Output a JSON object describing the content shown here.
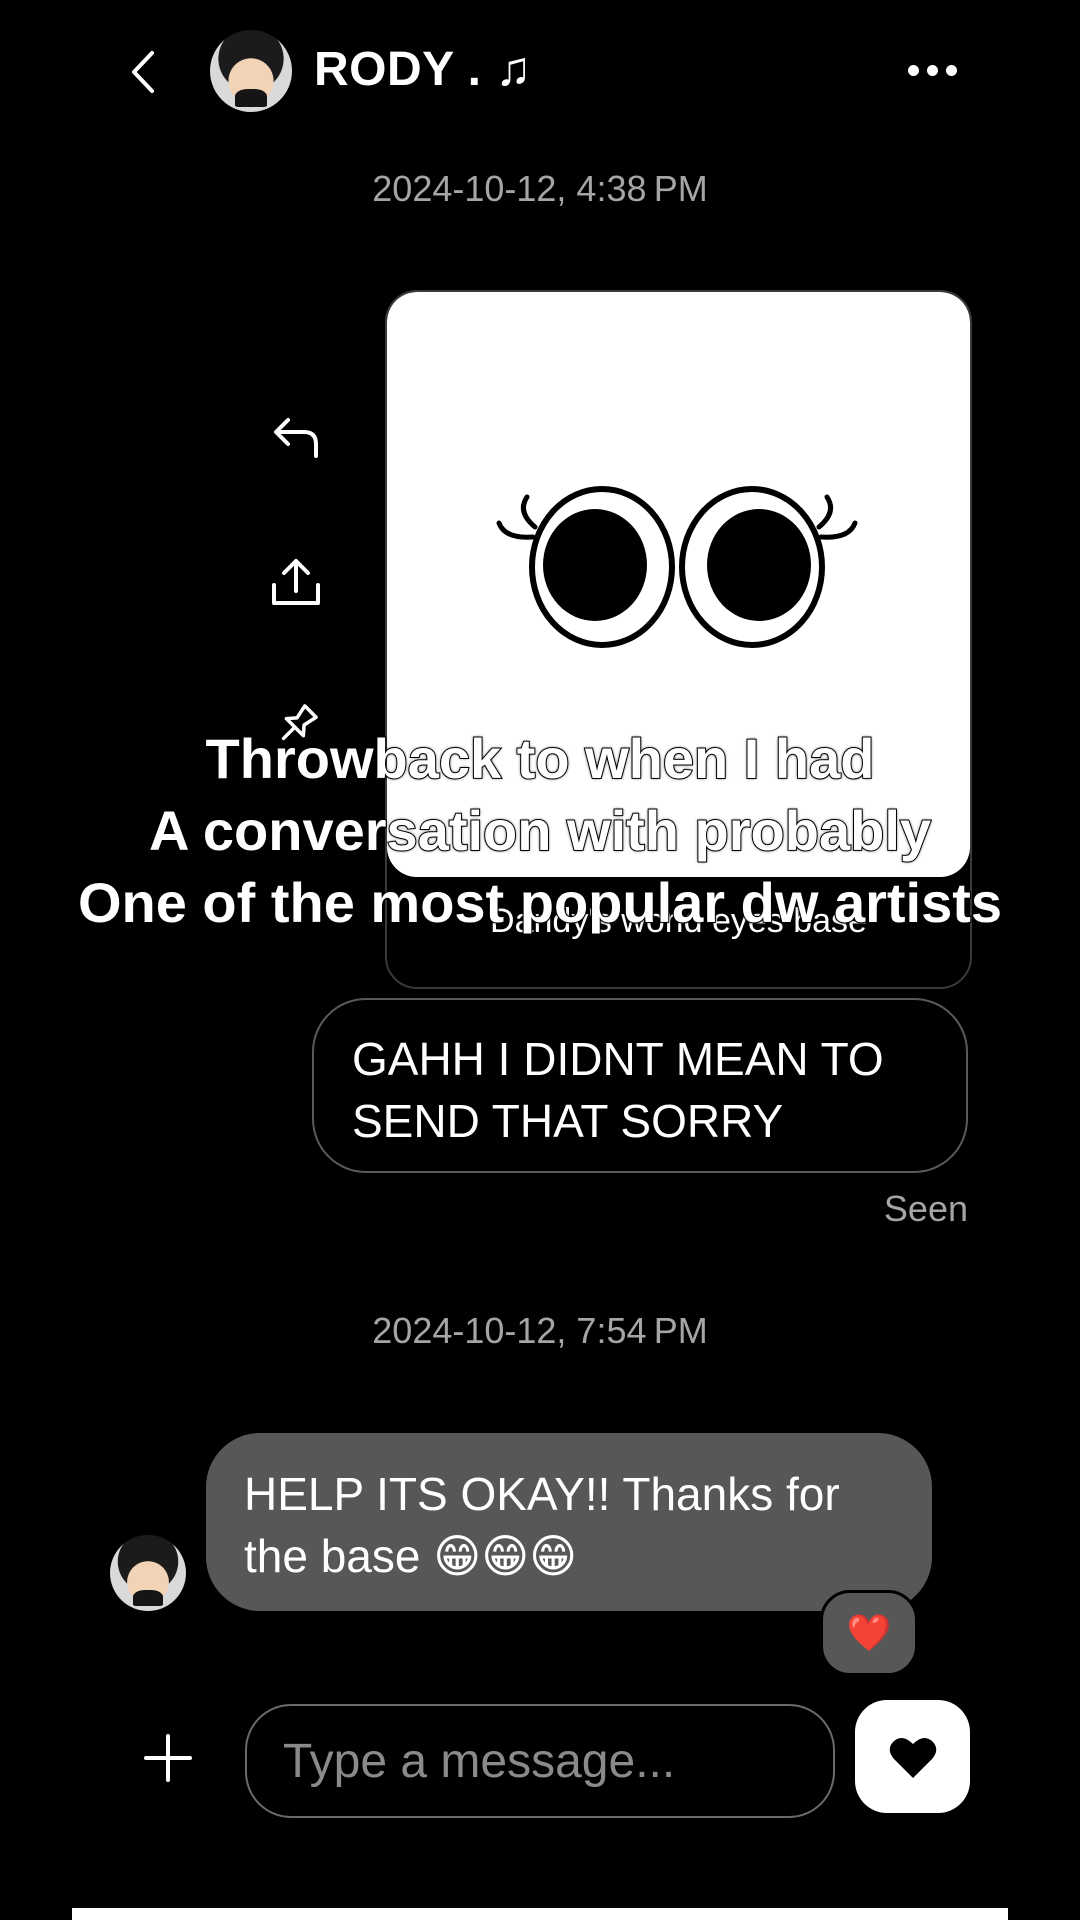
{
  "header": {
    "contact_name": "RODY . ♫",
    "back_icon": "chevron-left-icon",
    "more_icon": "more-horizontal-icon"
  },
  "messages": {
    "timestamp_1": "2024-10-12, 4:38 PM",
    "image_caption": "Dandy's world eyes base",
    "outgoing_text": "GAHH I DIDNT MEAN TO SEND THAT SORRY",
    "status": "Seen",
    "timestamp_2": "2024-10-12, 7:54 PM",
    "incoming_text": "HELP ITS OKAY!! Thanks for the base 😁😁😁",
    "reaction": "❤️"
  },
  "actions": {
    "reply_icon": "reply-icon",
    "share_icon": "share-icon",
    "pin_icon": "pin-icon"
  },
  "overlay": {
    "line1": "Throwback to when I had",
    "line2": "A conversation with probably",
    "line3": "One of the most popular dw artists"
  },
  "composer": {
    "placeholder": "Type a message...",
    "plus_icon": "plus-icon",
    "send_icon": "heart-icon"
  },
  "colors": {
    "background": "#000000",
    "incoming_bubble": "#575757",
    "muted_text": "#a5a5a5"
  }
}
